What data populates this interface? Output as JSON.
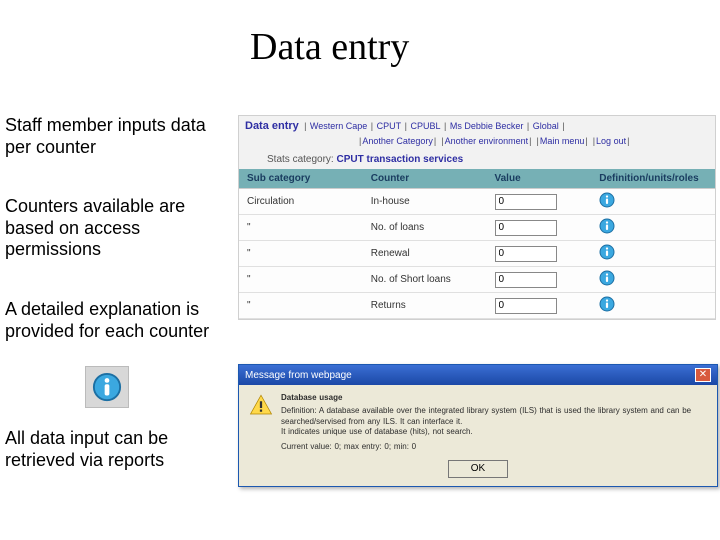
{
  "slide": {
    "title": "Data entry",
    "bullets": [
      "Staff member inputs data per counter",
      "Counters available are based on access permissions",
      "A detailed explanation is provided for each counter",
      "All data input can be retrieved via reports"
    ]
  },
  "app": {
    "title": "Data entry",
    "breadcrumb": [
      "Western Cape",
      "CPUT",
      "CPUBL",
      "Ms Debbie Becker",
      "Global"
    ],
    "subnav": [
      "Another Category",
      "Another environment",
      "Main menu",
      "Log out"
    ],
    "stats_label": "Stats category:",
    "stats_value": "CPUT transaction services",
    "columns": [
      "Sub category",
      "Counter",
      "Value",
      "Definition/units/roles"
    ],
    "rows": [
      {
        "sub": "Circulation",
        "counter": "In-house",
        "value": "0"
      },
      {
        "sub": "\"",
        "counter": "No. of loans",
        "value": "0"
      },
      {
        "sub": "\"",
        "counter": "Renewal",
        "value": "0"
      },
      {
        "sub": "\"",
        "counter": "No. of Short loans",
        "value": "0"
      },
      {
        "sub": "\"",
        "counter": "Returns",
        "value": "0"
      }
    ]
  },
  "msgbox": {
    "title": "Message from webpage",
    "line1": "Database usage",
    "line2": "Definition: A database available over the integrated library system (ILS) that is used the library system and can be searched/servised from any ILS. It can interface it.",
    "line3": "It indicates unique use of database (hits), not search.",
    "line4": "Current value: 0; max entry: 0; min: 0",
    "ok": "OK"
  },
  "colors": {
    "header_bg": "#76b0b5",
    "link": "#2e2ea3"
  }
}
